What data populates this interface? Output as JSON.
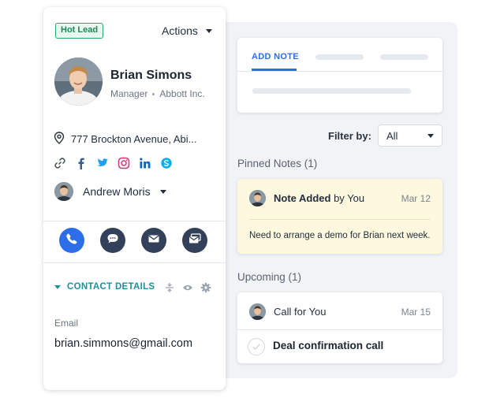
{
  "contact": {
    "badge": "Hot Lead",
    "actions_label": "Actions",
    "name": "Brian Simons",
    "role": "Manager",
    "company": "Abbott Inc.",
    "address": "777 Brockton Avenue, Abi...",
    "owner": "Andrew Moris",
    "social_icons": [
      "link-icon",
      "facebook-icon",
      "twitter-icon",
      "instagram-icon",
      "linkedin-icon",
      "skype-icon"
    ],
    "action_buttons": [
      "phone-icon",
      "chat-icon",
      "mail-icon",
      "bulk-mail-icon"
    ],
    "details_header": "CONTACT DETAILS",
    "email_label": "Email",
    "email_value": "brian.simmons@gmail.com"
  },
  "notes_panel": {
    "active_tab": "ADD NOTE",
    "filter_label": "Filter by:",
    "filter_value": "All",
    "pinned_header": "Pinned Notes (1)",
    "pinned_note": {
      "title_bold": "Note Added",
      "title_rest": " by You",
      "date": "Mar 12",
      "body": "Need to arrange a demo for Brian next week."
    },
    "upcoming_header": "Upcoming (1)",
    "upcoming_item": {
      "title": "Call for You",
      "date": "Mar 15",
      "task": "Deal confirmation call"
    }
  },
  "colors": {
    "accent_blue": "#2d6ee8",
    "teal": "#1f8f9c",
    "hot_lead_green": "#2aa76d",
    "pinned_bg": "#fdf8de"
  }
}
